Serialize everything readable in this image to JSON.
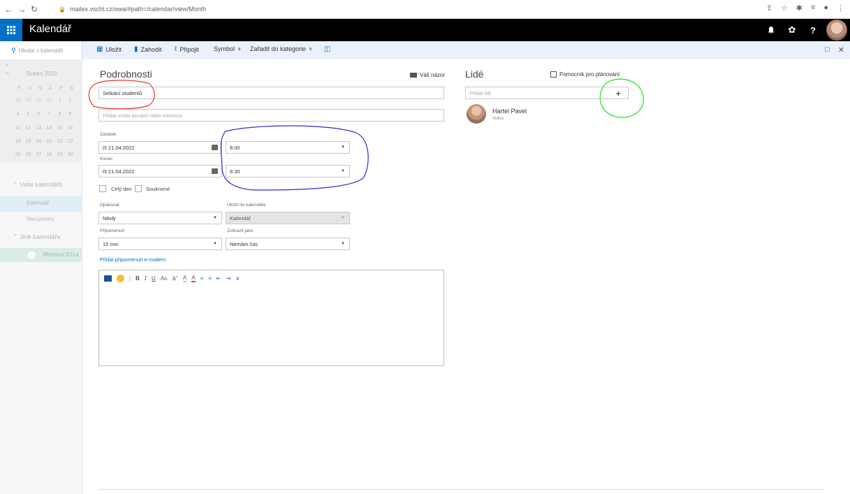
{
  "browser": {
    "url": "mailex.vscht.cz/owa/#path=/calendar/view/Month"
  },
  "app": {
    "title": "Kalendář",
    "help_label": "?"
  },
  "toolbar": {
    "search_placeholder": "Hledat v kalendáři",
    "save": "Uložit",
    "discard": "Zahodit",
    "attach": "Připojit",
    "symbol": "Symbol",
    "categorize": "Zařadit do kategorie"
  },
  "left_panel": {
    "month": "Duben 2022",
    "weekdays": [
      "P",
      "Ú",
      "S",
      "Č",
      "P",
      "S"
    ],
    "weeks": [
      [
        "28",
        "29",
        "30",
        "31",
        "1",
        "2"
      ],
      [
        "4",
        "5",
        "6",
        "7",
        "8",
        "9"
      ],
      [
        "11",
        "12",
        "13",
        "14",
        "15",
        "16"
      ],
      [
        "18",
        "19",
        "20",
        "21",
        "22",
        "23"
      ],
      [
        "25",
        "26",
        "27",
        "28",
        "29",
        "30"
      ]
    ],
    "your_calendars": "Vaše kalendáře",
    "calendar": "Kalendář",
    "birthdays": "Narozeniny",
    "other_calendars": "Jiné kalendáře",
    "room": "Místnost B11a"
  },
  "details": {
    "title": "Podrobnosti",
    "feedback": "Váš názor",
    "event_title": "Setkání studentů",
    "location_placeholder": "Přidat místo konání nebo místnost",
    "start_label": "Začátek",
    "start_date": "čt 21.04.2022",
    "start_time": "8:00",
    "end_label": "Konec",
    "end_date": "čt 21.04.2022",
    "end_time": "8:30",
    "all_day": "Celý den",
    "private": "Soukromé",
    "repeat_label": "Opakovat",
    "repeat_value": "Nikdy",
    "save_to_label": "Uložit do kalendáře",
    "save_to_value": "Kalendář",
    "reminder_label": "Připomenutí",
    "reminder_value": "15 min",
    "show_as_label": "Zobrazit jako",
    "show_as_value": "Nemám čas",
    "email_reminder_link": "Přidat připomenutí e-mailem"
  },
  "people": {
    "title": "Lidé",
    "scheduling_assistant": "Pomocník pro plánování",
    "add_placeholder": "Přidat lidi",
    "add_button": "+",
    "attendee_name": "Hartel Pavel",
    "attendee_status": "Volno"
  },
  "annotations": {
    "red": "#e53935",
    "blue": "#2b2bd6",
    "green": "#39e639"
  }
}
